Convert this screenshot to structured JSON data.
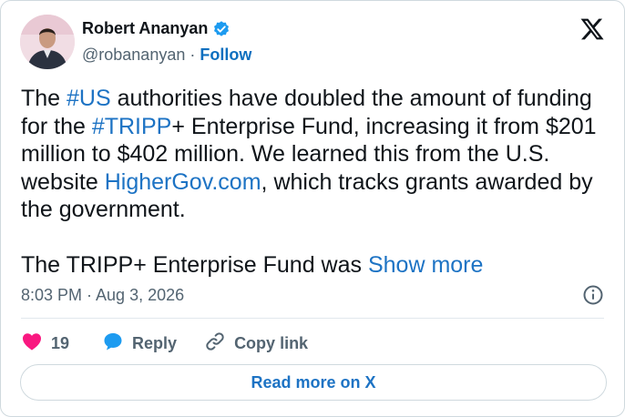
{
  "author": {
    "name": "Robert Ananyan",
    "handle": "@robananyan",
    "separator": "·",
    "follow_label": "Follow"
  },
  "tweet": {
    "text_part1": "The ",
    "hashtag1": "#US",
    "text_part2": " authorities have doubled the amount of funding for the ",
    "hashtag2": "#TRIPP",
    "text_part3": "+ Enterprise Fund, increasing it from $201 million to $402 million. We learned this from the U.S. website ",
    "link_text": "HigherGov.com",
    "text_part4": ", which tracks grants awarded by the government.",
    "paragraph2": "The TRIPP+ Enterprise Fund was ",
    "show_more_label": "Show more"
  },
  "timestamp": "8:03 PM · Aug 3, 2026",
  "actions": {
    "like_count": "19",
    "reply_label": "Reply",
    "copy_link_label": "Copy link"
  },
  "read_more_label": "Read more on X",
  "colors": {
    "accent": "#1d73c4",
    "like": "#f91880",
    "reply": "#1d9bf0",
    "verified": "#1d9bf0",
    "secondary_text": "#536471"
  },
  "icons": [
    "x-logo-icon",
    "verified-badge-icon",
    "info-icon",
    "heart-icon",
    "reply-icon",
    "link-icon"
  ]
}
